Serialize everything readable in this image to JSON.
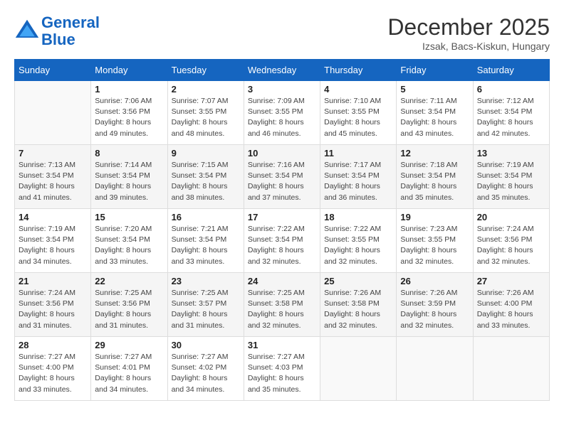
{
  "logo": {
    "line1": "General",
    "line2": "Blue"
  },
  "title": "December 2025",
  "location": "Izsak, Bacs-Kiskun, Hungary",
  "weekdays": [
    "Sunday",
    "Monday",
    "Tuesday",
    "Wednesday",
    "Thursday",
    "Friday",
    "Saturday"
  ],
  "weeks": [
    [
      {
        "day": "",
        "info": ""
      },
      {
        "day": "1",
        "info": "Sunrise: 7:06 AM\nSunset: 3:56 PM\nDaylight: 8 hours\nand 49 minutes."
      },
      {
        "day": "2",
        "info": "Sunrise: 7:07 AM\nSunset: 3:55 PM\nDaylight: 8 hours\nand 48 minutes."
      },
      {
        "day": "3",
        "info": "Sunrise: 7:09 AM\nSunset: 3:55 PM\nDaylight: 8 hours\nand 46 minutes."
      },
      {
        "day": "4",
        "info": "Sunrise: 7:10 AM\nSunset: 3:55 PM\nDaylight: 8 hours\nand 45 minutes."
      },
      {
        "day": "5",
        "info": "Sunrise: 7:11 AM\nSunset: 3:54 PM\nDaylight: 8 hours\nand 43 minutes."
      },
      {
        "day": "6",
        "info": "Sunrise: 7:12 AM\nSunset: 3:54 PM\nDaylight: 8 hours\nand 42 minutes."
      }
    ],
    [
      {
        "day": "7",
        "info": "Sunrise: 7:13 AM\nSunset: 3:54 PM\nDaylight: 8 hours\nand 41 minutes."
      },
      {
        "day": "8",
        "info": "Sunrise: 7:14 AM\nSunset: 3:54 PM\nDaylight: 8 hours\nand 39 minutes."
      },
      {
        "day": "9",
        "info": "Sunrise: 7:15 AM\nSunset: 3:54 PM\nDaylight: 8 hours\nand 38 minutes."
      },
      {
        "day": "10",
        "info": "Sunrise: 7:16 AM\nSunset: 3:54 PM\nDaylight: 8 hours\nand 37 minutes."
      },
      {
        "day": "11",
        "info": "Sunrise: 7:17 AM\nSunset: 3:54 PM\nDaylight: 8 hours\nand 36 minutes."
      },
      {
        "day": "12",
        "info": "Sunrise: 7:18 AM\nSunset: 3:54 PM\nDaylight: 8 hours\nand 35 minutes."
      },
      {
        "day": "13",
        "info": "Sunrise: 7:19 AM\nSunset: 3:54 PM\nDaylight: 8 hours\nand 35 minutes."
      }
    ],
    [
      {
        "day": "14",
        "info": "Sunrise: 7:19 AM\nSunset: 3:54 PM\nDaylight: 8 hours\nand 34 minutes."
      },
      {
        "day": "15",
        "info": "Sunrise: 7:20 AM\nSunset: 3:54 PM\nDaylight: 8 hours\nand 33 minutes."
      },
      {
        "day": "16",
        "info": "Sunrise: 7:21 AM\nSunset: 3:54 PM\nDaylight: 8 hours\nand 33 minutes."
      },
      {
        "day": "17",
        "info": "Sunrise: 7:22 AM\nSunset: 3:54 PM\nDaylight: 8 hours\nand 32 minutes."
      },
      {
        "day": "18",
        "info": "Sunrise: 7:22 AM\nSunset: 3:55 PM\nDaylight: 8 hours\nand 32 minutes."
      },
      {
        "day": "19",
        "info": "Sunrise: 7:23 AM\nSunset: 3:55 PM\nDaylight: 8 hours\nand 32 minutes."
      },
      {
        "day": "20",
        "info": "Sunrise: 7:24 AM\nSunset: 3:56 PM\nDaylight: 8 hours\nand 32 minutes."
      }
    ],
    [
      {
        "day": "21",
        "info": "Sunrise: 7:24 AM\nSunset: 3:56 PM\nDaylight: 8 hours\nand 31 minutes."
      },
      {
        "day": "22",
        "info": "Sunrise: 7:25 AM\nSunset: 3:56 PM\nDaylight: 8 hours\nand 31 minutes."
      },
      {
        "day": "23",
        "info": "Sunrise: 7:25 AM\nSunset: 3:57 PM\nDaylight: 8 hours\nand 31 minutes."
      },
      {
        "day": "24",
        "info": "Sunrise: 7:25 AM\nSunset: 3:58 PM\nDaylight: 8 hours\nand 32 minutes."
      },
      {
        "day": "25",
        "info": "Sunrise: 7:26 AM\nSunset: 3:58 PM\nDaylight: 8 hours\nand 32 minutes."
      },
      {
        "day": "26",
        "info": "Sunrise: 7:26 AM\nSunset: 3:59 PM\nDaylight: 8 hours\nand 32 minutes."
      },
      {
        "day": "27",
        "info": "Sunrise: 7:26 AM\nSunset: 4:00 PM\nDaylight: 8 hours\nand 33 minutes."
      }
    ],
    [
      {
        "day": "28",
        "info": "Sunrise: 7:27 AM\nSunset: 4:00 PM\nDaylight: 8 hours\nand 33 minutes."
      },
      {
        "day": "29",
        "info": "Sunrise: 7:27 AM\nSunset: 4:01 PM\nDaylight: 8 hours\nand 34 minutes."
      },
      {
        "day": "30",
        "info": "Sunrise: 7:27 AM\nSunset: 4:02 PM\nDaylight: 8 hours\nand 34 minutes."
      },
      {
        "day": "31",
        "info": "Sunrise: 7:27 AM\nSunset: 4:03 PM\nDaylight: 8 hours\nand 35 minutes."
      },
      {
        "day": "",
        "info": ""
      },
      {
        "day": "",
        "info": ""
      },
      {
        "day": "",
        "info": ""
      }
    ]
  ]
}
